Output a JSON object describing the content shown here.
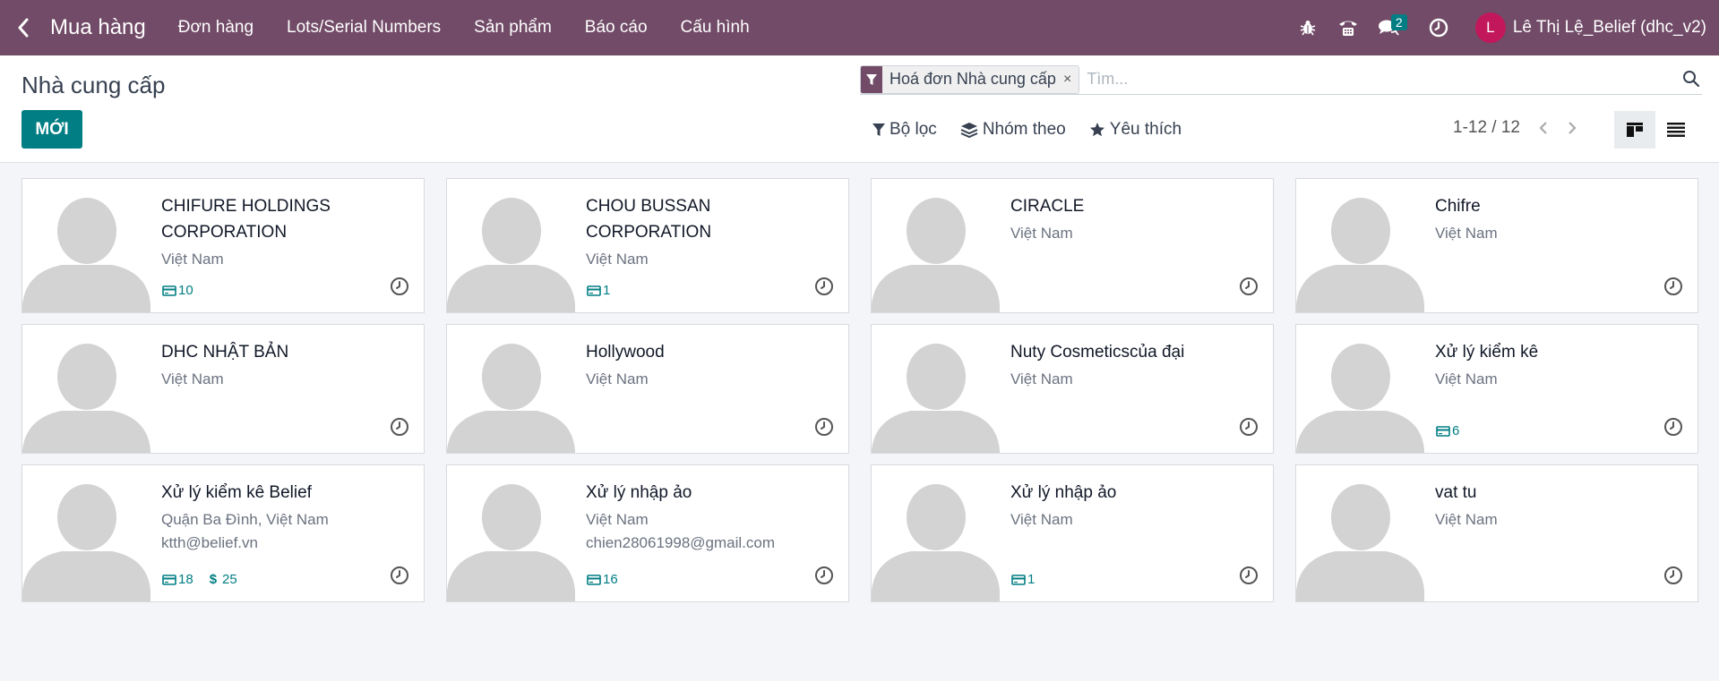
{
  "app": {
    "name": "Mua hàng"
  },
  "menu": [
    "Đơn hàng",
    "Lots/Serial Numbers",
    "Sản phẩm",
    "Báo cáo",
    "Cấu hình"
  ],
  "systray": {
    "messages_badge": "2"
  },
  "user": {
    "initial": "L",
    "name": "Lê Thị Lệ_Belief (dhc_v2)",
    "avatar_color": "#c2185b"
  },
  "page": {
    "title": "Nhà cung cấp"
  },
  "new_button": "MỚI",
  "search": {
    "facet": "Hoá đơn Nhà cung cấp",
    "facet_remove": "×",
    "placeholder": "Tìm..."
  },
  "filters": {
    "filter": "Bộ lọc",
    "group_by": "Nhóm theo",
    "favorites": "Yêu thích"
  },
  "pager": {
    "value": "1-12 / 12"
  },
  "colors": {
    "brand": "#714b67",
    "accent": "#017e84"
  },
  "cards": [
    {
      "name": "CHIFURE HOLDINGS CORPORATION",
      "address": "Việt Nam",
      "email": "",
      "bills": "10",
      "amount": ""
    },
    {
      "name": "CHOU BUSSAN CORPORATION",
      "address": "Việt Nam",
      "email": "",
      "bills": "1",
      "amount": ""
    },
    {
      "name": "CIRACLE",
      "address": "Việt Nam",
      "email": "",
      "bills": "",
      "amount": ""
    },
    {
      "name": "Chifre",
      "address": "Việt Nam",
      "email": "",
      "bills": "",
      "amount": ""
    },
    {
      "name": "DHC NHẬT BẢN",
      "address": "Việt Nam",
      "email": "",
      "bills": "",
      "amount": ""
    },
    {
      "name": "Hollywood",
      "address": "Việt Nam",
      "email": "",
      "bills": "",
      "amount": ""
    },
    {
      "name": "Nuty Cosmeticscủa đại",
      "address": "Việt Nam",
      "email": "",
      "bills": "",
      "amount": ""
    },
    {
      "name": "Xử lý kiểm kê",
      "address": "Việt Nam",
      "email": "",
      "bills": "6",
      "amount": ""
    },
    {
      "name": "Xử lý kiểm kê Belief",
      "address": "Quận Ba Đình, Việt Nam",
      "email": "ktth@belief.vn",
      "bills": "18",
      "amount": "25"
    },
    {
      "name": "Xử lý nhập ảo",
      "address": "Việt Nam",
      "email": "chien28061998@gmail.com",
      "bills": "16",
      "amount": ""
    },
    {
      "name": "Xử lý nhập ảo",
      "address": "Việt Nam",
      "email": "",
      "bills": "1",
      "amount": ""
    },
    {
      "name": "vat tu",
      "address": "Việt Nam",
      "email": "",
      "bills": "",
      "amount": ""
    }
  ]
}
